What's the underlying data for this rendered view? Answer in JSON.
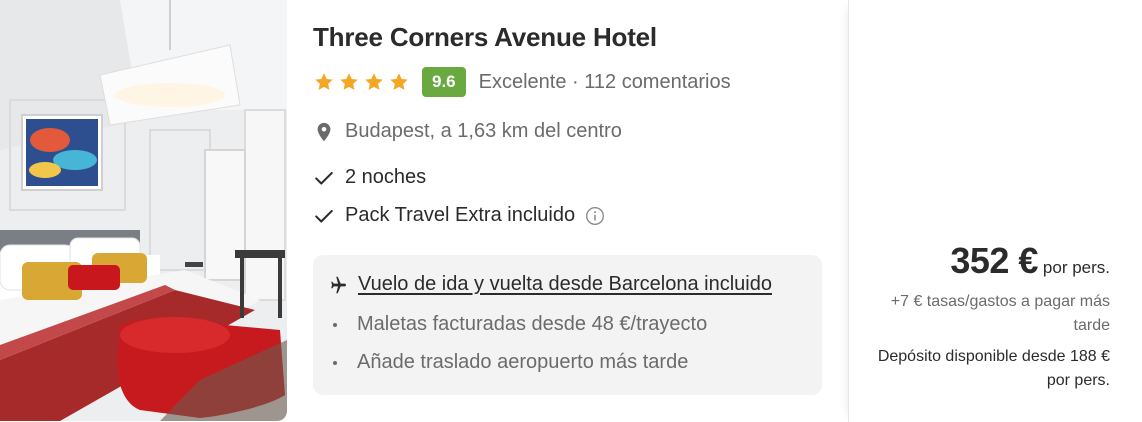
{
  "hotel": {
    "name": "Three Corners Avenue Hotel",
    "stars": 4,
    "star_icon": "star-icon",
    "score": "9.6",
    "rating_text": "Excelente · 112 comentarios",
    "location": "Budapest, a 1,63 km del centro",
    "features": [
      "2 noches",
      "Pack Travel Extra incluido"
    ]
  },
  "flight": {
    "title": "Vuelo de ida y vuelta desde Barcelona incluido",
    "bullets": [
      "Maletas facturadas desde 48 €/trayecto",
      "Añade traslado aeropuerto más tarde"
    ]
  },
  "price": {
    "amount": "352 €",
    "unit": "por pers.",
    "taxes": "+7 € tasas/gastos a pagar más tarde",
    "deposit": "Depósito disponible desde 188 € por pers."
  },
  "colors": {
    "star": "#f5a623",
    "score_badge": "#6aa93f",
    "text_primary": "#2b2b2b",
    "text_secondary": "#6b6b6b",
    "flight_box": "#f3f3f3"
  }
}
